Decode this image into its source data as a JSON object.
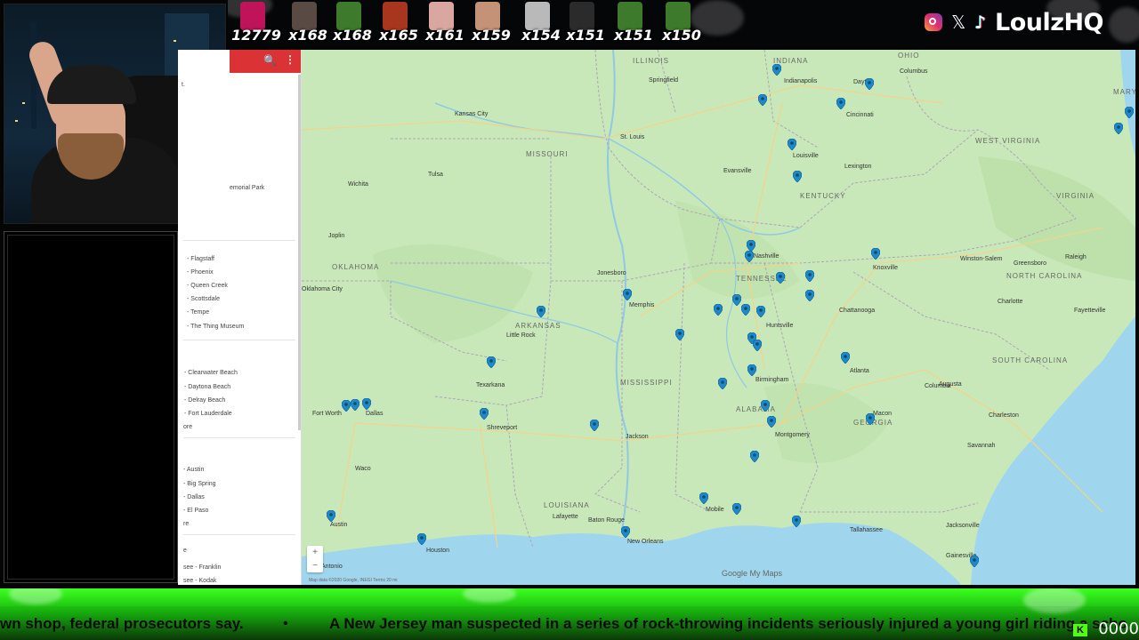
{
  "top_bar": {
    "badges": [
      {
        "count": "12779",
        "color": "#c0145a"
      },
      {
        "count": "x168",
        "color": "#5a4a44"
      },
      {
        "count": "x168",
        "color": "#3d7a2b"
      },
      {
        "count": "x165",
        "color": "#a8361e"
      },
      {
        "count": "x161",
        "color": "#d9a6a0"
      },
      {
        "count": "x159",
        "color": "#c49276"
      },
      {
        "count": "x154",
        "color": "#b9b9b9"
      },
      {
        "count": "x151",
        "color": "#2b2b2b"
      },
      {
        "count": "x151",
        "color": "#3d7a2b"
      },
      {
        "count": "x150",
        "color": "#3d7a2b"
      }
    ],
    "socials": {
      "instagram": "instagram-icon",
      "x": "𝕏",
      "tiktok": "♪"
    },
    "brand": "LoulzHQ"
  },
  "sidebar": {
    "items_top": [
      "t.",
      "emorial Park"
    ],
    "group_az": [
      "- Flagstaff",
      "- Phoenix",
      "- Queen Creek",
      "- Scottsdale",
      "- Tempe",
      "- The Thing Museum"
    ],
    "group_fl": [
      "- Clearwater Beach",
      "- Daytona Beach",
      "- Delray Beach",
      "- Fort Lauderdale",
      "ore"
    ],
    "group_tx": [
      "- Austin",
      "- Big Spring",
      "- Dallas",
      "- El Paso",
      "re"
    ],
    "group_tn": [
      "e",
      "see - Franklin",
      "see - Kodak"
    ]
  },
  "map": {
    "state_labels": [
      "ILLINOIS",
      "INDIANA",
      "OHIO",
      "MISSOURI",
      "KENTUCKY",
      "WEST VIRGINIA",
      "VIRGINIA",
      "MARYL",
      "OKLAHOMA",
      "ARKANSAS",
      "TENNESSEE",
      "NORTH CAROLINA",
      "SOUTH CAROLINA",
      "MISSISSIPPI",
      "ALABAMA",
      "GEORGIA",
      "LOUISIANA"
    ],
    "city_labels": [
      "Kansas City",
      "St. Louis",
      "Indianapolis",
      "Columbus",
      "Cincinnati",
      "Louisville",
      "Dayton",
      "Springfield",
      "Wichita",
      "Nashville",
      "Knoxville",
      "Charlotte",
      "Chattanooga",
      "Memphis",
      "Atlanta",
      "Birmingham",
      "Huntsville",
      "Montgomery",
      "Jackson",
      "Shreveport",
      "Dallas",
      "Fort Worth",
      "Austin",
      "Houston",
      "Baton Rouge",
      "New Orleans",
      "Mobile",
      "Tallahassee",
      "Jacksonville",
      "Savannah",
      "Charleston",
      "Columbia",
      "Augusta",
      "Macon",
      "Tulsa",
      "Oklahoma City",
      "Little Rock",
      "Greensboro",
      "Raleigh",
      "Winston-Salem",
      "Lexington",
      "Evansville",
      "Jonesboro",
      "Texarkana",
      "San Antonio",
      "Waco",
      "Lafayette",
      "Gainesville",
      "Fayetteville",
      "Joplin"
    ],
    "attribution": "Map data ©2020 Google, INEGI    Terms    20 mi",
    "logo": "Google My Maps",
    "zoom_in": "+",
    "zoom_out": "−"
  },
  "ticker": {
    "left_text": "wn shop, federal prosecutors say.",
    "separator": "•",
    "main_text": "A New Jersey man suspected in a series of rock-throwing incidents seriously injured a young girl riding a scho",
    "counter": "0000"
  }
}
